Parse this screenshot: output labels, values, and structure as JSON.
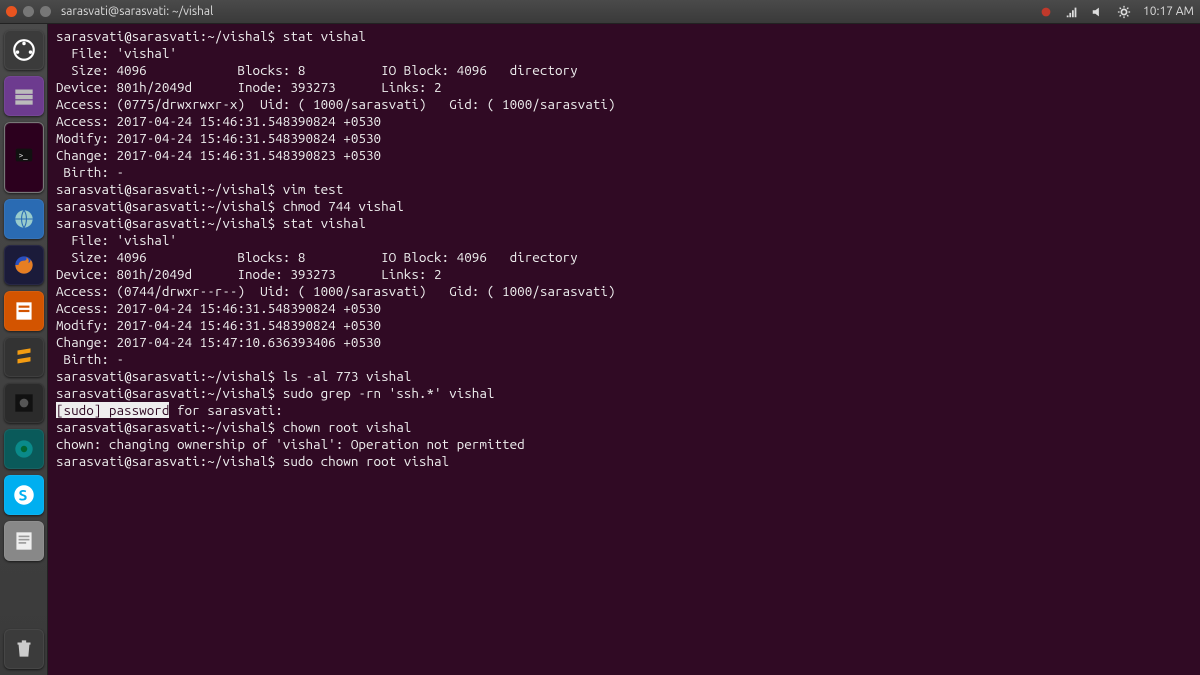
{
  "menubar": {
    "title": "sarasvati@sarasvati: ~/vishal",
    "clock": "10:17 AM",
    "tray_icons": [
      "bug-icon",
      "network-icon",
      "volume-icon",
      "gear-icon"
    ]
  },
  "launcher": {
    "items": [
      {
        "name": "dash-icon",
        "interactable": true
      },
      {
        "name": "files-icon",
        "interactable": true
      },
      {
        "name": "terminal-icon",
        "interactable": true
      },
      {
        "name": "browser-icon",
        "interactable": true
      },
      {
        "name": "firefox-icon",
        "interactable": true
      },
      {
        "name": "editor-icon",
        "interactable": true
      },
      {
        "name": "sublime-icon",
        "interactable": true
      },
      {
        "name": "app-dark-icon",
        "interactable": true
      },
      {
        "name": "app-teal-icon",
        "interactable": true
      },
      {
        "name": "skype-icon",
        "interactable": true
      },
      {
        "name": "notes-icon",
        "interactable": true
      }
    ],
    "trash": {
      "name": "trash-icon",
      "interactable": true
    }
  },
  "terminal": {
    "lines": [
      "sarasvati@sarasvati:~/vishal$ stat vishal",
      "  File: 'vishal'",
      "  Size: 4096            Blocks: 8          IO Block: 4096   directory",
      "Device: 801h/2049d      Inode: 393273      Links: 2",
      "Access: (0775/drwxrwxr-x)  Uid: ( 1000/sarasvati)   Gid: ( 1000/sarasvati)",
      "Access: 2017-04-24 15:46:31.548390824 +0530",
      "Modify: 2017-04-24 15:46:31.548390824 +0530",
      "Change: 2017-04-24 15:46:31.548390823 +0530",
      " Birth: -",
      "sarasvati@sarasvati:~/vishal$ vim test",
      "sarasvati@sarasvati:~/vishal$ chmod 744 vishal",
      "sarasvati@sarasvati:~/vishal$ stat vishal",
      "  File: 'vishal'",
      "  Size: 4096            Blocks: 8          IO Block: 4096   directory",
      "Device: 801h/2049d      Inode: 393273      Links: 2",
      "Access: (0744/drwxr--r--)  Uid: ( 1000/sarasvati)   Gid: ( 1000/sarasvati)",
      "Access: 2017-04-24 15:46:31.548390824 +0530",
      "Modify: 2017-04-24 15:46:31.548390824 +0530",
      "Change: 2017-04-24 15:47:10.636393406 +0530",
      " Birth: -",
      "sarasvati@sarasvati:~/vishal$ ls -al 773 vishal",
      "sarasvati@sarasvati:~/vishal$ sudo grep -rn 'ssh.*' vishal",
      "",
      "sarasvati@sarasvati:~/vishal$ chown root vishal",
      "chown: changing ownership of 'vishal': Operation not permitted",
      "sarasvati@sarasvati:~/vishal$ sudo chown root vishal"
    ],
    "highlight_line_index": 22,
    "highlight_text": "[sudo] password for sarasvati:",
    "highlight_prefix": "[sudo] password",
    "highlight_suffix": " for sarasvati:"
  }
}
